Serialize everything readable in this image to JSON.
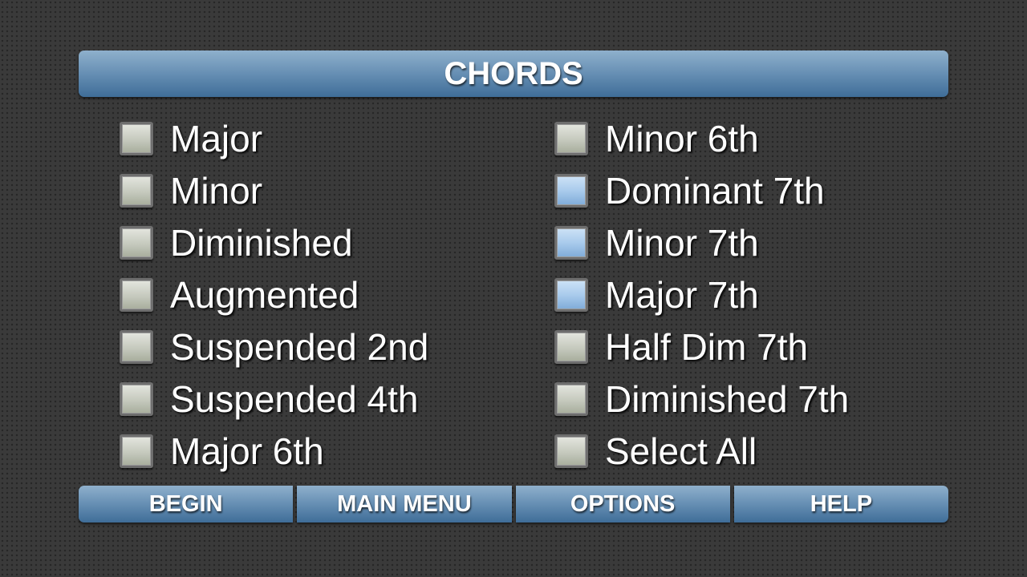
{
  "header": {
    "title": "CHORDS"
  },
  "options_left": [
    {
      "label": "Major",
      "checked": false
    },
    {
      "label": "Minor",
      "checked": false
    },
    {
      "label": "Diminished",
      "checked": false
    },
    {
      "label": "Augmented",
      "checked": false
    },
    {
      "label": "Suspended 2nd",
      "checked": false
    },
    {
      "label": "Suspended 4th",
      "checked": false
    },
    {
      "label": "Major 6th",
      "checked": false
    }
  ],
  "options_right": [
    {
      "label": "Minor 6th",
      "checked": false
    },
    {
      "label": "Dominant 7th",
      "checked": true
    },
    {
      "label": "Minor 7th",
      "checked": true
    },
    {
      "label": "Major 7th",
      "checked": true
    },
    {
      "label": "Half Dim 7th",
      "checked": false
    },
    {
      "label": "Diminished 7th",
      "checked": false
    },
    {
      "label": "Select All",
      "checked": false
    }
  ],
  "footer": {
    "begin_label": "BEGIN",
    "main_menu_label": "MAIN MENU",
    "options_label": "OPTIONS",
    "help_label": "HELP"
  },
  "colors": {
    "accent": "#5b86ae",
    "checked": "#a9cbec",
    "unchecked": "#c5c9bd",
    "background": "#3a3a3a"
  }
}
